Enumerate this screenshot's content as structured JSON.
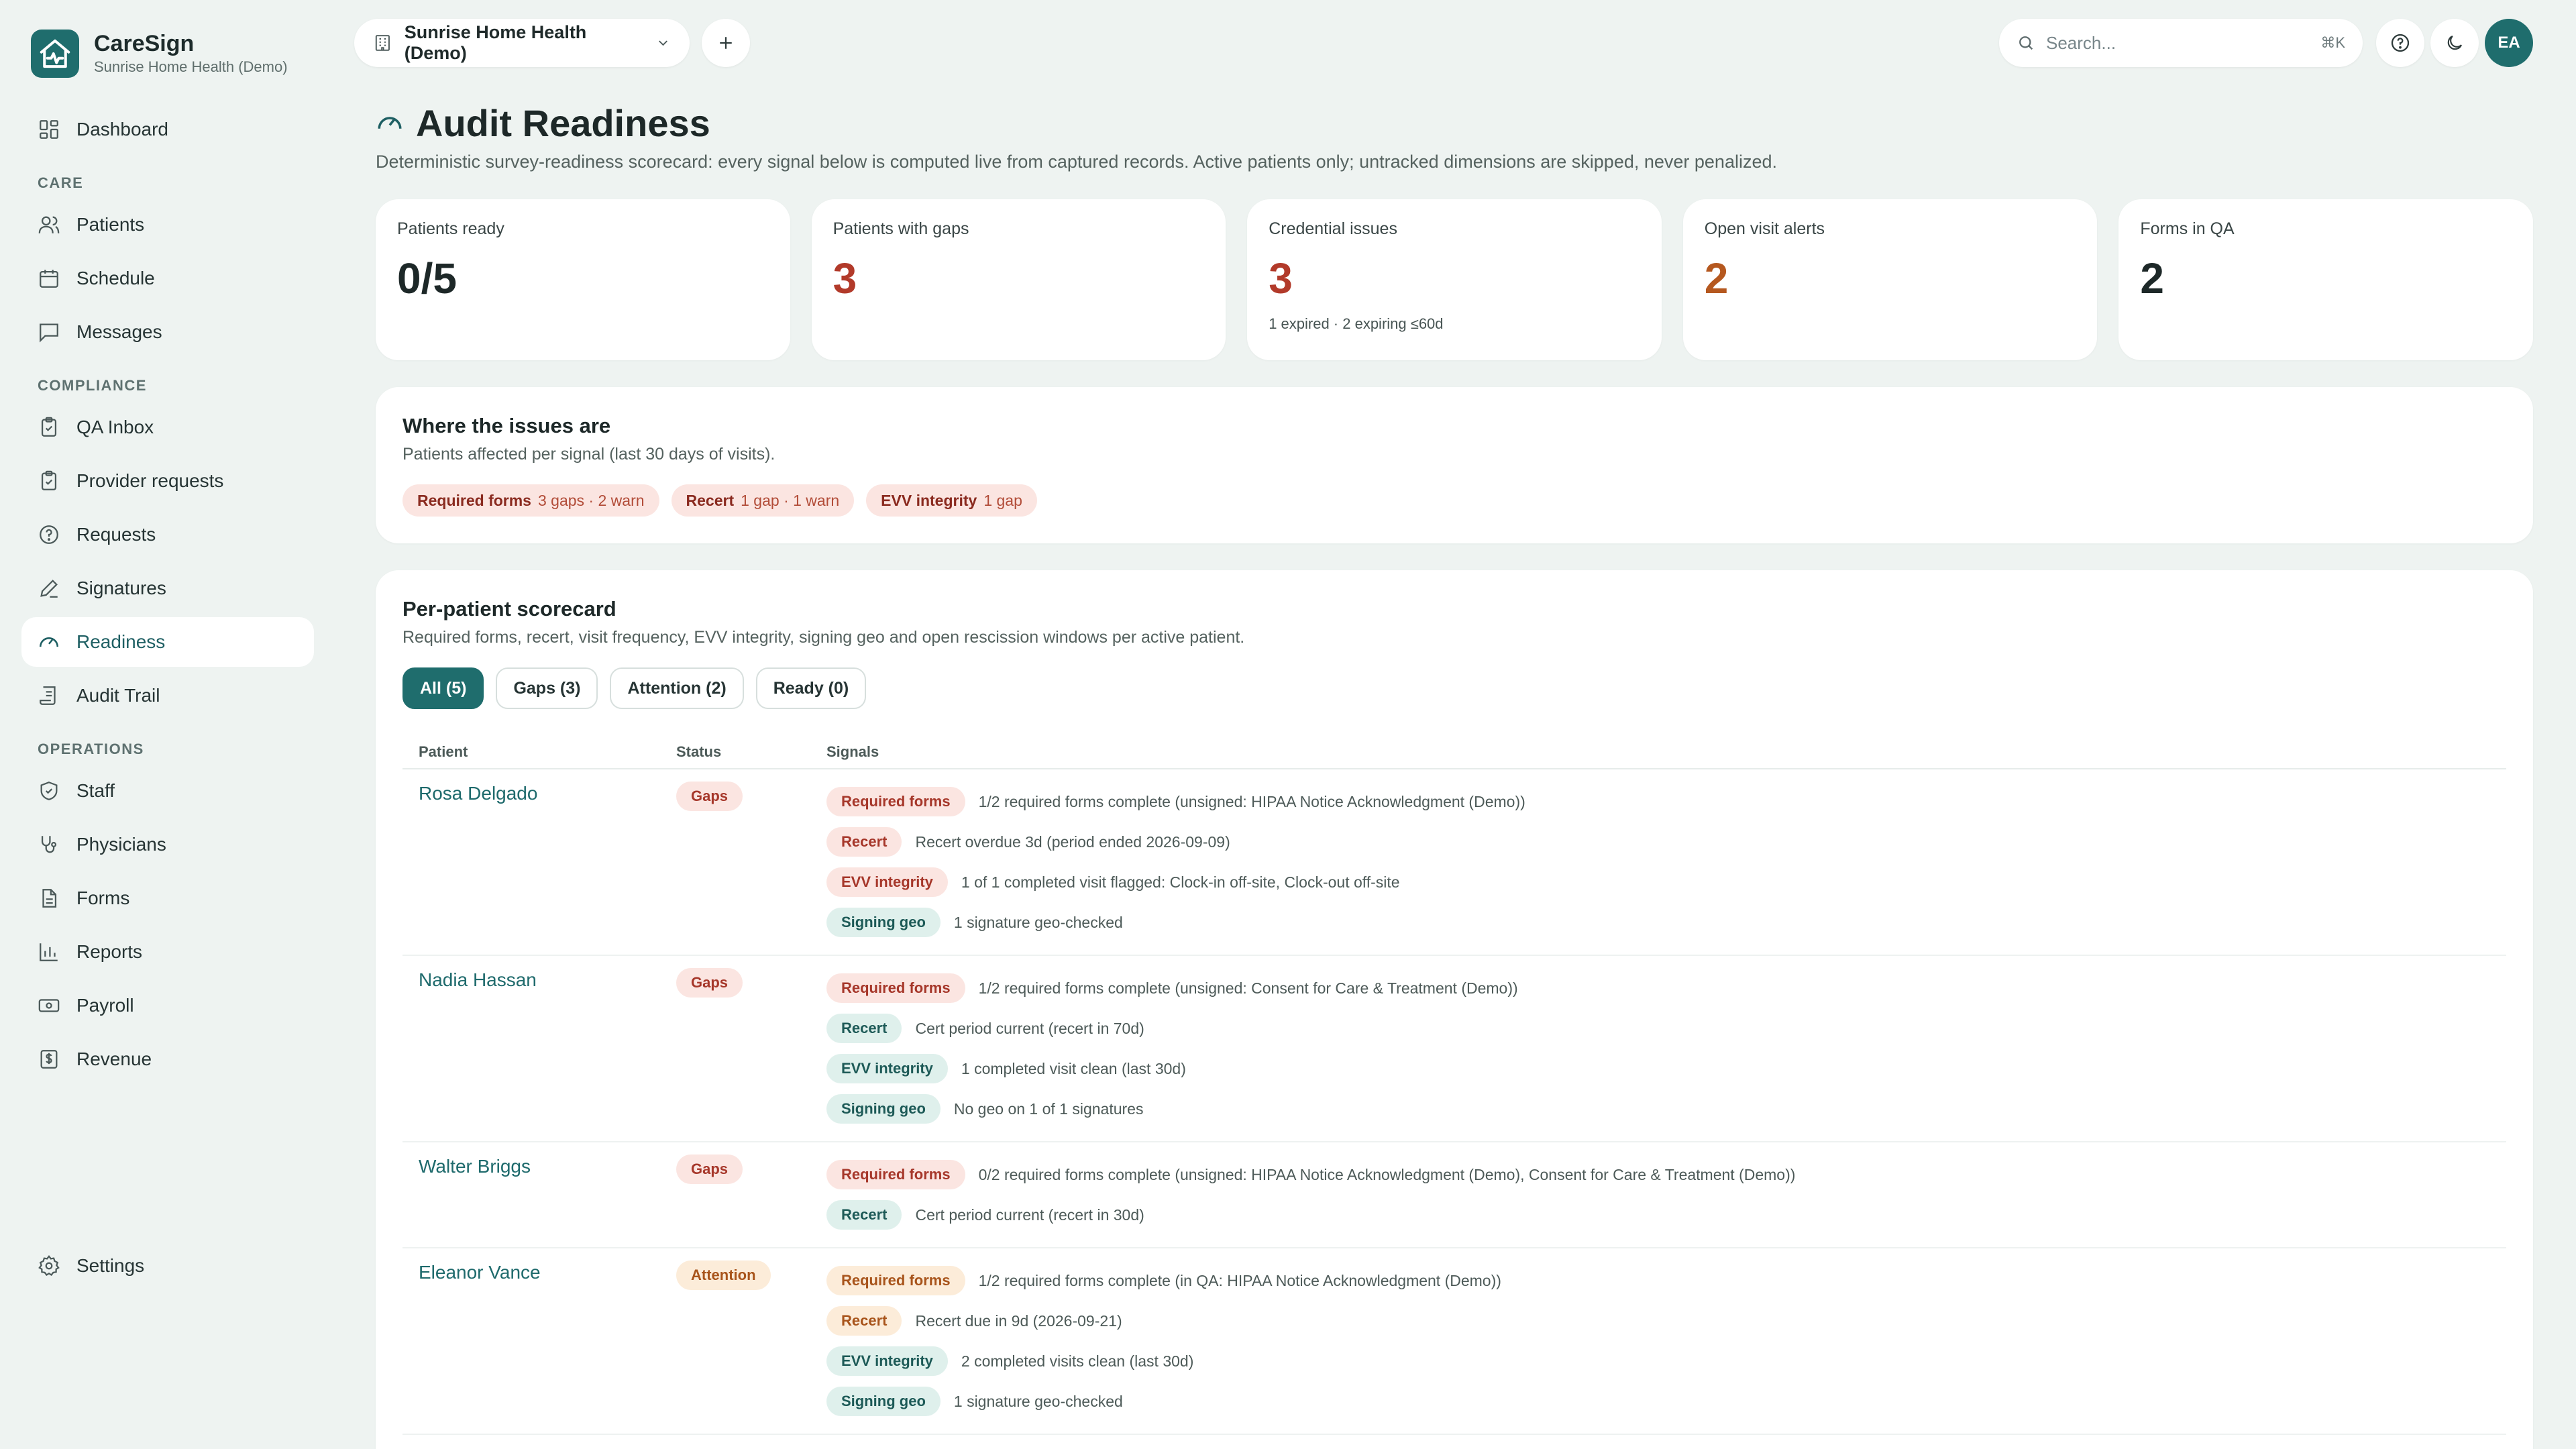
{
  "brand": {
    "name": "CareSign",
    "org": "Sunrise Home Health (Demo)"
  },
  "nav": {
    "dashboard": "Dashboard",
    "care_label": "CARE",
    "care": [
      "Patients",
      "Schedule",
      "Messages"
    ],
    "compliance_label": "COMPLIANCE",
    "compliance": [
      "QA Inbox",
      "Provider requests",
      "Requests",
      "Signatures",
      "Readiness",
      "Audit Trail"
    ],
    "operations_label": "OPERATIONS",
    "operations": [
      "Staff",
      "Physicians",
      "Forms",
      "Reports",
      "Payroll",
      "Revenue"
    ],
    "settings": "Settings",
    "active": "Readiness"
  },
  "topbar": {
    "org_select": "Sunrise Home Health (Demo)",
    "search_placeholder": "Search...",
    "search_shortcut": "⌘K",
    "avatar_initials": "EA"
  },
  "page": {
    "title": "Audit Readiness",
    "description": "Deterministic survey-readiness scorecard: every signal below is computed live from captured records. Active patients only; untracked dimensions are skipped, never penalized."
  },
  "stats": [
    {
      "label": "Patients ready",
      "value": "0/5",
      "sub": "",
      "color": "#1d2828"
    },
    {
      "label": "Patients with gaps",
      "value": "3",
      "sub": "",
      "color": "#b23a2a"
    },
    {
      "label": "Credential issues",
      "value": "3",
      "sub": "1 expired · 2 expiring ≤60d",
      "color": "#b23a2a"
    },
    {
      "label": "Open visit alerts",
      "value": "2",
      "sub": "",
      "color": "#b5581f"
    },
    {
      "label": "Forms in QA",
      "value": "2",
      "sub": "",
      "color": "#1d2828"
    }
  ],
  "issues": {
    "title": "Where the issues are",
    "description": "Patients affected per signal (last 30 days of visits).",
    "chips": [
      {
        "label": "Required forms",
        "value": "3 gaps · 2 warn"
      },
      {
        "label": "Recert",
        "value": "1 gap · 1 warn"
      },
      {
        "label": "EVV integrity",
        "value": "1 gap"
      }
    ]
  },
  "scorecard": {
    "title": "Per-patient scorecard",
    "description": "Required forms, recert, visit frequency, EVV integrity, signing geo and open rescission windows per active patient.",
    "filters": [
      "All (5)",
      "Gaps (3)",
      "Attention (2)",
      "Ready (0)"
    ],
    "active_filter": "All (5)",
    "headers": {
      "patient": "Patient",
      "status": "Status",
      "signals": "Signals"
    },
    "rows": [
      {
        "patient": "Rosa Delgado",
        "status": "Gaps",
        "status_kind": "gaps",
        "signals": [
          {
            "label": "Required forms",
            "kind": "gap",
            "text": "1/2 required forms complete (unsigned: HIPAA Notice Acknowledgment (Demo))"
          },
          {
            "label": "Recert",
            "kind": "gap",
            "text": "Recert overdue 3d (period ended 2026-09-09)"
          },
          {
            "label": "EVV integrity",
            "kind": "gap",
            "text": "1 of 1 completed visit flagged: Clock-in off-site, Clock-out off-site"
          },
          {
            "label": "Signing geo",
            "kind": "ok",
            "text": "1 signature geo-checked"
          }
        ]
      },
      {
        "patient": "Nadia Hassan",
        "status": "Gaps",
        "status_kind": "gaps",
        "signals": [
          {
            "label": "Required forms",
            "kind": "gap",
            "text": "1/2 required forms complete (unsigned: Consent for Care & Treatment (Demo))"
          },
          {
            "label": "Recert",
            "kind": "ok",
            "text": "Cert period current (recert in 70d)"
          },
          {
            "label": "EVV integrity",
            "kind": "ok",
            "text": "1 completed visit clean (last 30d)"
          },
          {
            "label": "Signing geo",
            "kind": "ok",
            "text": "No geo on 1 of 1 signatures"
          }
        ]
      },
      {
        "patient": "Walter Briggs",
        "status": "Gaps",
        "status_kind": "gaps",
        "signals": [
          {
            "label": "Required forms",
            "kind": "gap",
            "text": "0/2 required forms complete (unsigned: HIPAA Notice Acknowledgment (Demo), Consent for Care & Treatment (Demo))"
          },
          {
            "label": "Recert",
            "kind": "ok",
            "text": "Cert period current (recert in 30d)"
          }
        ]
      },
      {
        "patient": "Eleanor Vance",
        "status": "Attention",
        "status_kind": "attention",
        "signals": [
          {
            "label": "Required forms",
            "kind": "warn",
            "text": "1/2 required forms complete (in QA: HIPAA Notice Acknowledgment (Demo))"
          },
          {
            "label": "Recert",
            "kind": "warn",
            "text": "Recert due in 9d (2026-09-21)"
          },
          {
            "label": "EVV integrity",
            "kind": "ok",
            "text": "2 completed visits clean (last 30d)"
          },
          {
            "label": "Signing geo",
            "kind": "ok",
            "text": "1 signature geo-checked"
          }
        ]
      }
    ]
  }
}
